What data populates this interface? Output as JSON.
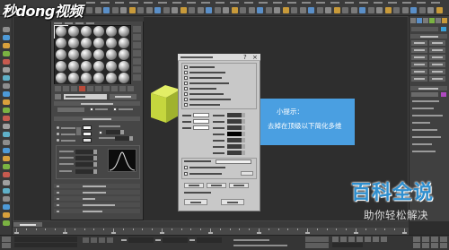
{
  "logo": {
    "text": "秒dong视频"
  },
  "tip": {
    "title": "小提示：",
    "body": "去掉在顶级以下简化多维"
  },
  "watermark": {
    "brand": "百科全说",
    "slogan": "助你轻松解决"
  },
  "dialog": {
    "help_glyph": "?",
    "close_glyph": "×",
    "help_icon": "question-icon",
    "close_icon": "close-icon"
  },
  "material_editor": {
    "sample_icon": "material-sphere-icon"
  },
  "colors": {
    "tip_background": "#4a9fe1",
    "watermark_brand": "#2f8fcf",
    "object_top": "#e2ee66",
    "object_left": "#c5d63e",
    "object_right": "#a0b22e",
    "viewport": "#2e2e2e"
  }
}
